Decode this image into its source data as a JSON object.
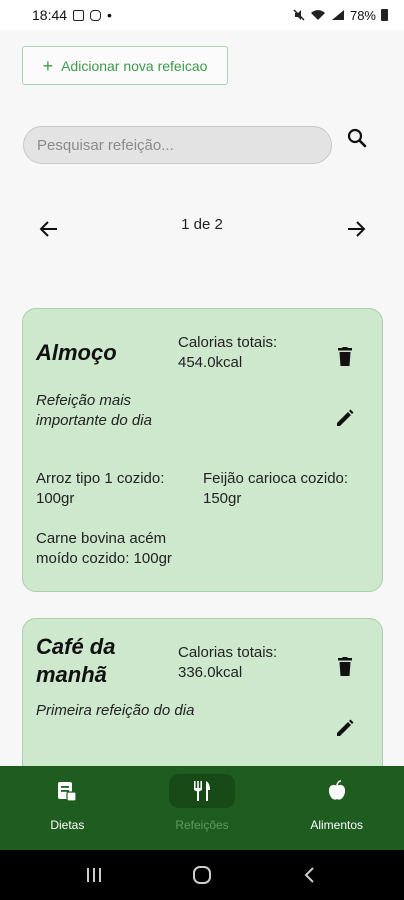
{
  "status_bar": {
    "time": "18:44",
    "battery": "78%"
  },
  "toolbar": {
    "add_label": "Adicionar nova refeicao"
  },
  "search": {
    "placeholder": "Pesquisar refeição..."
  },
  "pagination": {
    "text": "1 de 2"
  },
  "meals": [
    {
      "title": "Almoço",
      "calories_label": "Calorias totais:",
      "calories_value": "454.0kcal",
      "description": "Refeição mais importante do dia",
      "foods": [
        "Arroz tipo 1 cozido: 100gr",
        "Feijão carioca cozido: 150gr",
        "Carne bovina acém moído cozido: 100gr"
      ]
    },
    {
      "title": "Café da manhã",
      "calories_label": "Calorias totais:",
      "calories_value": "336.0kcal",
      "description": "Primeira refeição do dia",
      "foods": []
    }
  ],
  "bottom_nav": {
    "items": [
      {
        "label": "Dietas",
        "icon": "diet-list-icon",
        "active": false
      },
      {
        "label": "Refeições",
        "icon": "fork-knife-icon",
        "active": true
      },
      {
        "label": "Alimentos",
        "icon": "apple-icon",
        "active": false
      }
    ]
  },
  "colors": {
    "accent": "#3e9a4a",
    "card_bg": "#cde8cd",
    "nav_bg": "#1f5c1f",
    "nav_active_pill": "#174a17"
  }
}
